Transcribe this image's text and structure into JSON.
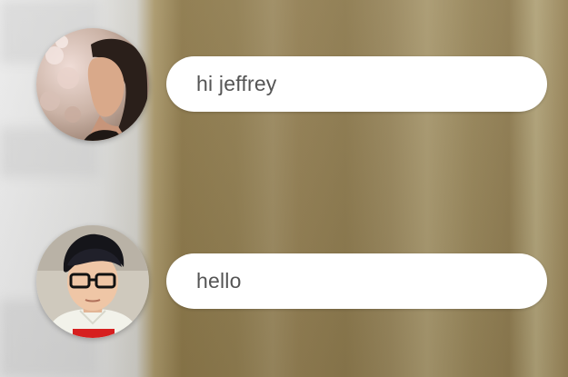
{
  "conversation": {
    "messages": [
      {
        "text": "hi jeffrey",
        "avatar": "woman-avatar"
      },
      {
        "text": "hello",
        "avatar": "man-avatar"
      }
    ]
  },
  "colors": {
    "bubble": "#ffffff",
    "text": "#555555",
    "background": "#8c794d"
  }
}
